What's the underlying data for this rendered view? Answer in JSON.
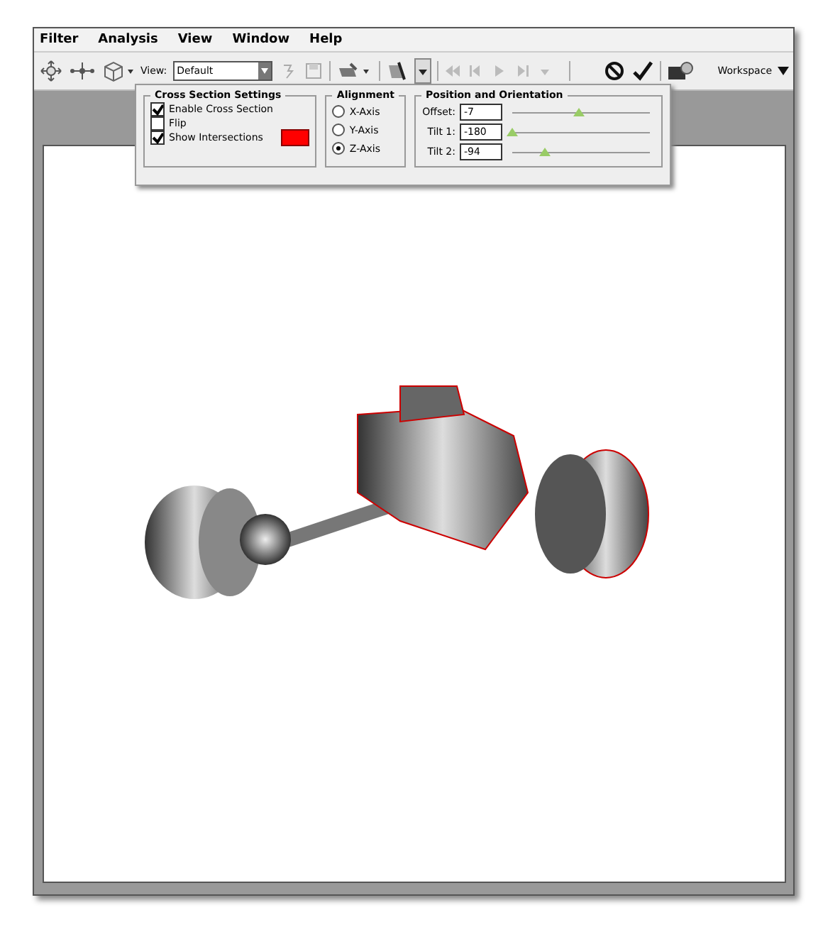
{
  "menu": [
    "Filter",
    "Analysis",
    "View",
    "Window",
    "Help"
  ],
  "toolbar": {
    "view_label": "View:",
    "view_value": "Default",
    "workspace": "Workspace"
  },
  "cross_section": {
    "title": "Cross Section Settings",
    "options": [
      {
        "label": "Enable Cross Section",
        "checked": true
      },
      {
        "label": "Flip",
        "checked": false
      },
      {
        "label": "Show Intersections",
        "checked": true,
        "color": "#ff0000"
      }
    ]
  },
  "alignment": {
    "title": "Alignment",
    "options": [
      {
        "label": "X-Axis",
        "selected": false
      },
      {
        "label": "Y-Axis",
        "selected": false
      },
      {
        "label": "Z-Axis",
        "selected": true
      }
    ]
  },
  "position": {
    "title": "Position and Orientation",
    "rows": [
      {
        "label": "Offset:",
        "value": "-7",
        "level": 0.48
      },
      {
        "label": "Tilt 1:",
        "value": "-180",
        "level": 0
      },
      {
        "label": "Tilt 2:",
        "value": "-94",
        "level": 0.24
      }
    ]
  }
}
